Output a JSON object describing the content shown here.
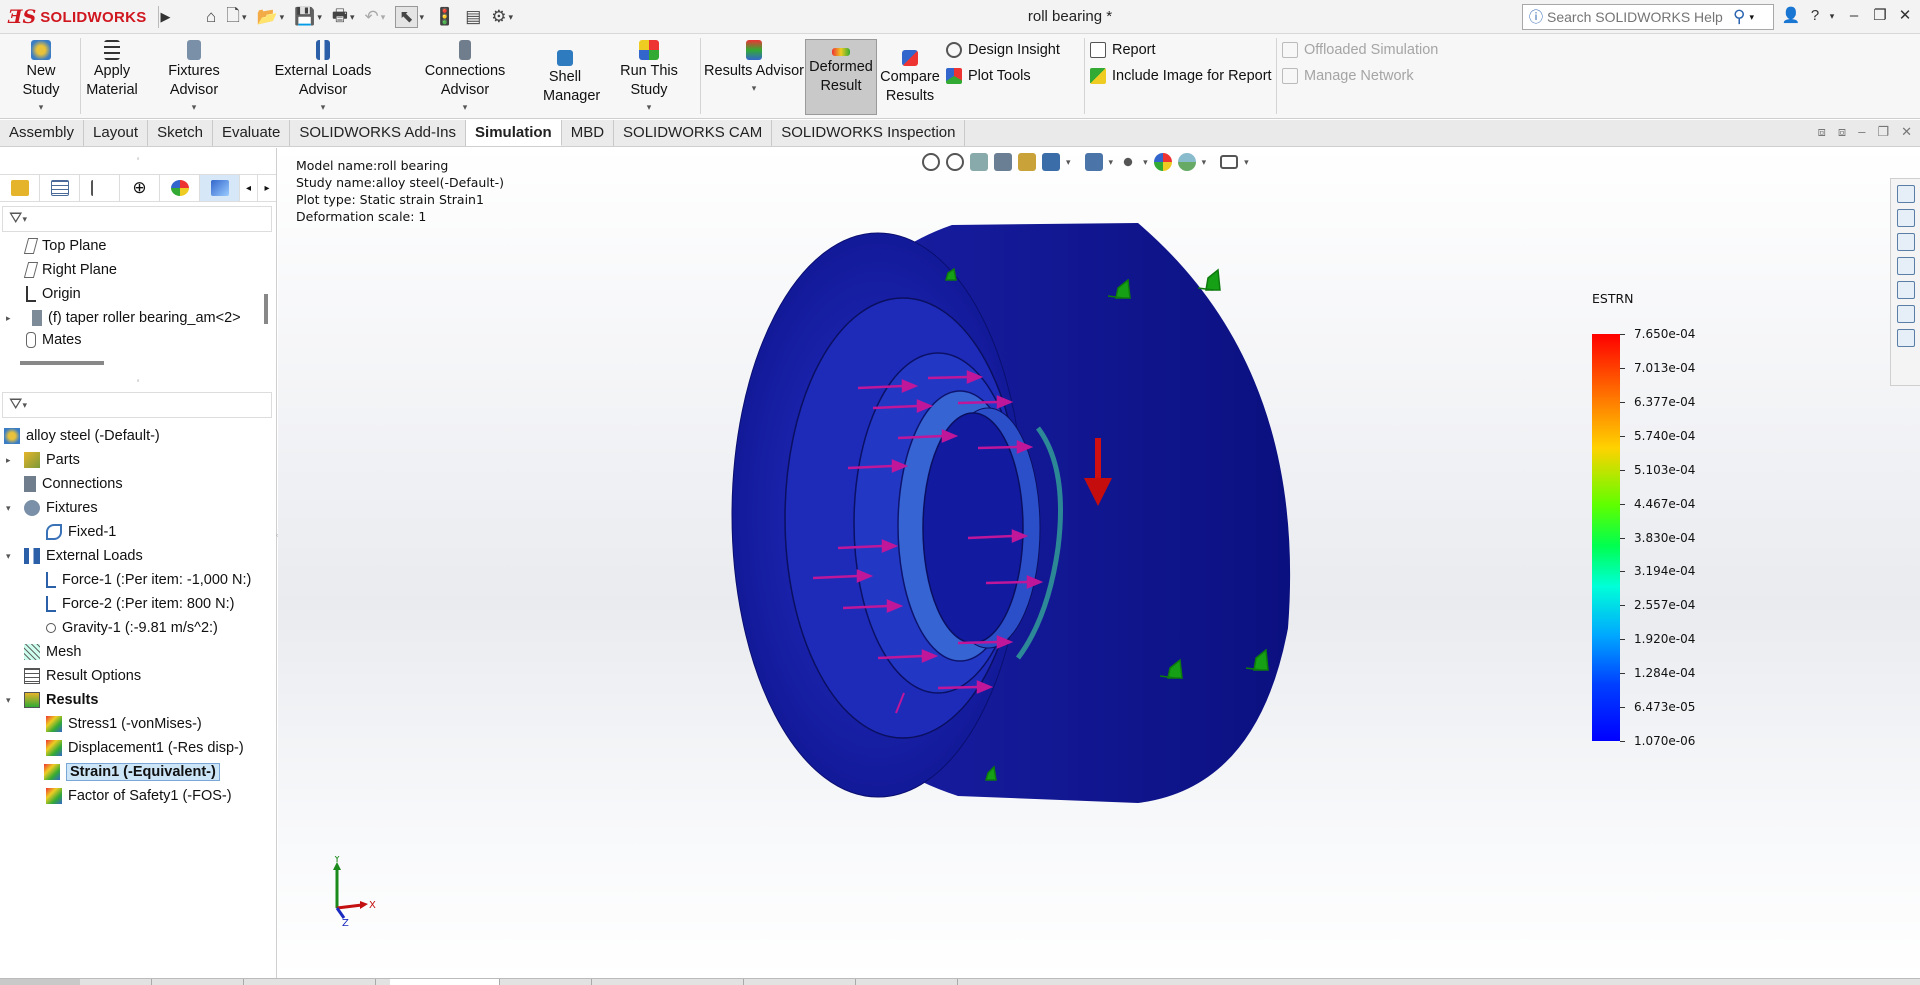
{
  "titlebar": {
    "app_name": "SOLIDWORKS",
    "doc_title": "roll bearing *",
    "search_placeholder": "Search SOLIDWORKS Help"
  },
  "ribbon": {
    "new_study": "New Study",
    "apply_material": "Apply Material",
    "fixtures_advisor": "Fixtures Advisor",
    "external_loads_advisor": "External Loads Advisor",
    "connections_advisor": "Connections Advisor",
    "shell_manager": "Shell Manager",
    "run_this_study": "Run This Study",
    "results_advisor": "Results Advisor",
    "deformed_result": "Deformed Result",
    "compare_results": "Compare Results",
    "design_insight": "Design Insight",
    "plot_tools": "Plot Tools",
    "report": "Report",
    "include_image": "Include Image for Report",
    "offloaded_simulation": "Offloaded Simulation",
    "manage_network": "Manage Network"
  },
  "tabs": [
    "Assembly",
    "Layout",
    "Sketch",
    "Evaluate",
    "SOLIDWORKS Add-Ins",
    "Simulation",
    "MBD",
    "SOLIDWORKS CAM",
    "SOLIDWORKS Inspection"
  ],
  "active_tab": "Simulation",
  "feature_tree": {
    "items": [
      "Top Plane",
      "Right Plane",
      "Origin",
      "(f) taper roller bearing_am<2>",
      "Mates"
    ]
  },
  "study_tree": {
    "root": "alloy steel (-Default-)",
    "parts": "Parts",
    "connections": "Connections",
    "fixtures": "Fixtures",
    "fixed1": "Fixed-1",
    "external_loads": "External Loads",
    "force1": "Force-1 (:Per item: -1,000 N:)",
    "force2": "Force-2 (:Per item: 800 N:)",
    "gravity1": "Gravity-1 (:-9.81 m/s^2:)",
    "mesh": "Mesh",
    "result_options": "Result Options",
    "results": "Results",
    "stress1": "Stress1 (-vonMises-)",
    "displacement1": "Displacement1 (-Res disp-)",
    "strain1": "Strain1 (-Equivalent-)",
    "fos1": "Factor of Safety1 (-FOS-)"
  },
  "graphics": {
    "model_name": "Model name:roll bearing",
    "study_name": "Study name:alloy steel(-Default-)",
    "plot_type": "Plot type: Static strain Strain1",
    "deformation_scale": "Deformation scale: 1"
  },
  "legend": {
    "title": "ESTRN",
    "values": [
      "7.650e-04",
      "7.013e-04",
      "6.377e-04",
      "5.740e-04",
      "5.103e-04",
      "4.467e-04",
      "3.830e-04",
      "3.194e-04",
      "2.557e-04",
      "1.920e-04",
      "1.284e-04",
      "6.473e-05",
      "1.070e-06"
    ]
  },
  "triad": {
    "y": "Y",
    "x": "X",
    "z": "Z"
  },
  "colors": {
    "brand_red": "#d0171f",
    "model_blue": "#1d22b8",
    "arrow_magenta": "#c0169a",
    "fixture_green": "#16a016"
  }
}
